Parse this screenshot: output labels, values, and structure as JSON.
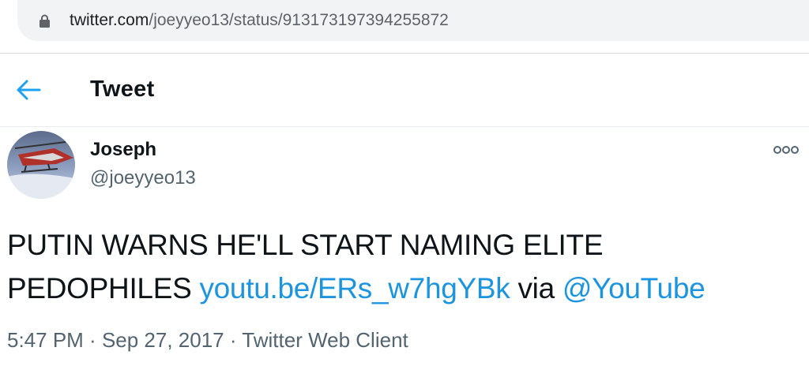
{
  "browser": {
    "url_host": "twitter.com",
    "url_path": "/joeyyeo13/status/913173197394255872"
  },
  "header": {
    "title": "Tweet"
  },
  "tweet": {
    "author": {
      "display_name": "Joseph",
      "handle": "@joeyyeo13"
    },
    "text": {
      "line1": "PUTIN WARNS HE'LL START NAMING ELITE",
      "line2_prefix": "PEDOPHILES ",
      "link": "youtu.be/ERs_w7hgYBk",
      "via": " via ",
      "mention": "@YouTube"
    },
    "meta": {
      "time": "5:47 PM",
      "separator": " · ",
      "date": "Sep 27, 2017",
      "client": "Twitter Web Client"
    }
  },
  "icons": {
    "lock": "lock-icon",
    "back": "arrow-left-icon",
    "more": "more-horizontal-icon"
  },
  "colors": {
    "link": "#1b95e0",
    "text": "#0f1419",
    "secondary": "#536471",
    "urlbar_bg": "#f1f3f4"
  }
}
